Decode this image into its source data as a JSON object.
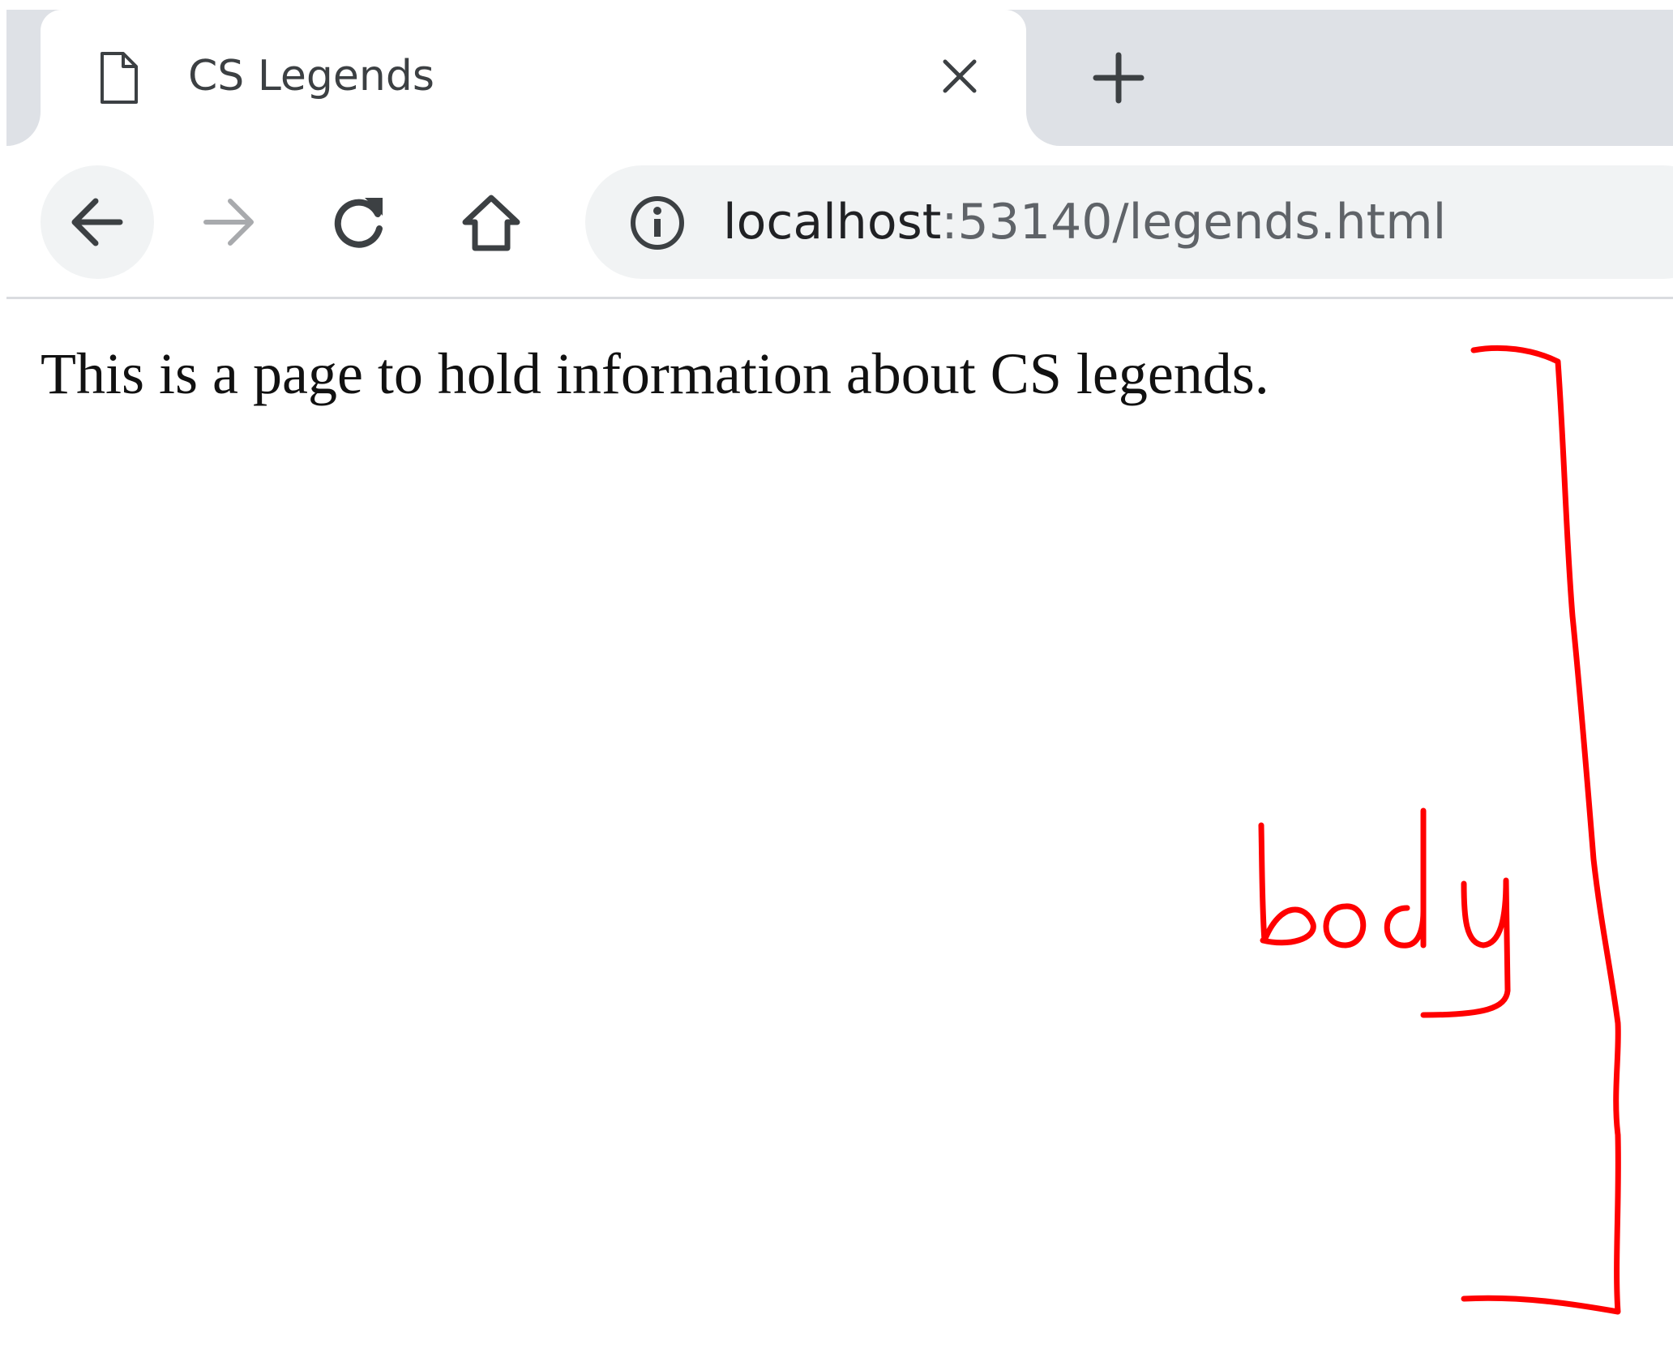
{
  "browser": {
    "tab": {
      "title": "CS Legends",
      "icon": "document-icon"
    },
    "new_tab_icon": "plus-icon",
    "close_icon": "close-icon",
    "nav": {
      "back_icon": "arrow-left-icon",
      "forward_icon": "arrow-right-icon",
      "reload_icon": "reload-icon",
      "home_icon": "home-icon"
    },
    "address_bar": {
      "info_icon": "info-icon",
      "url_host": "localhost",
      "url_rest": ":53140/legends.html"
    }
  },
  "page": {
    "text": "This is a page to hold information about CS legends."
  },
  "annotation": {
    "label": "body",
    "color": "#ff0000"
  }
}
